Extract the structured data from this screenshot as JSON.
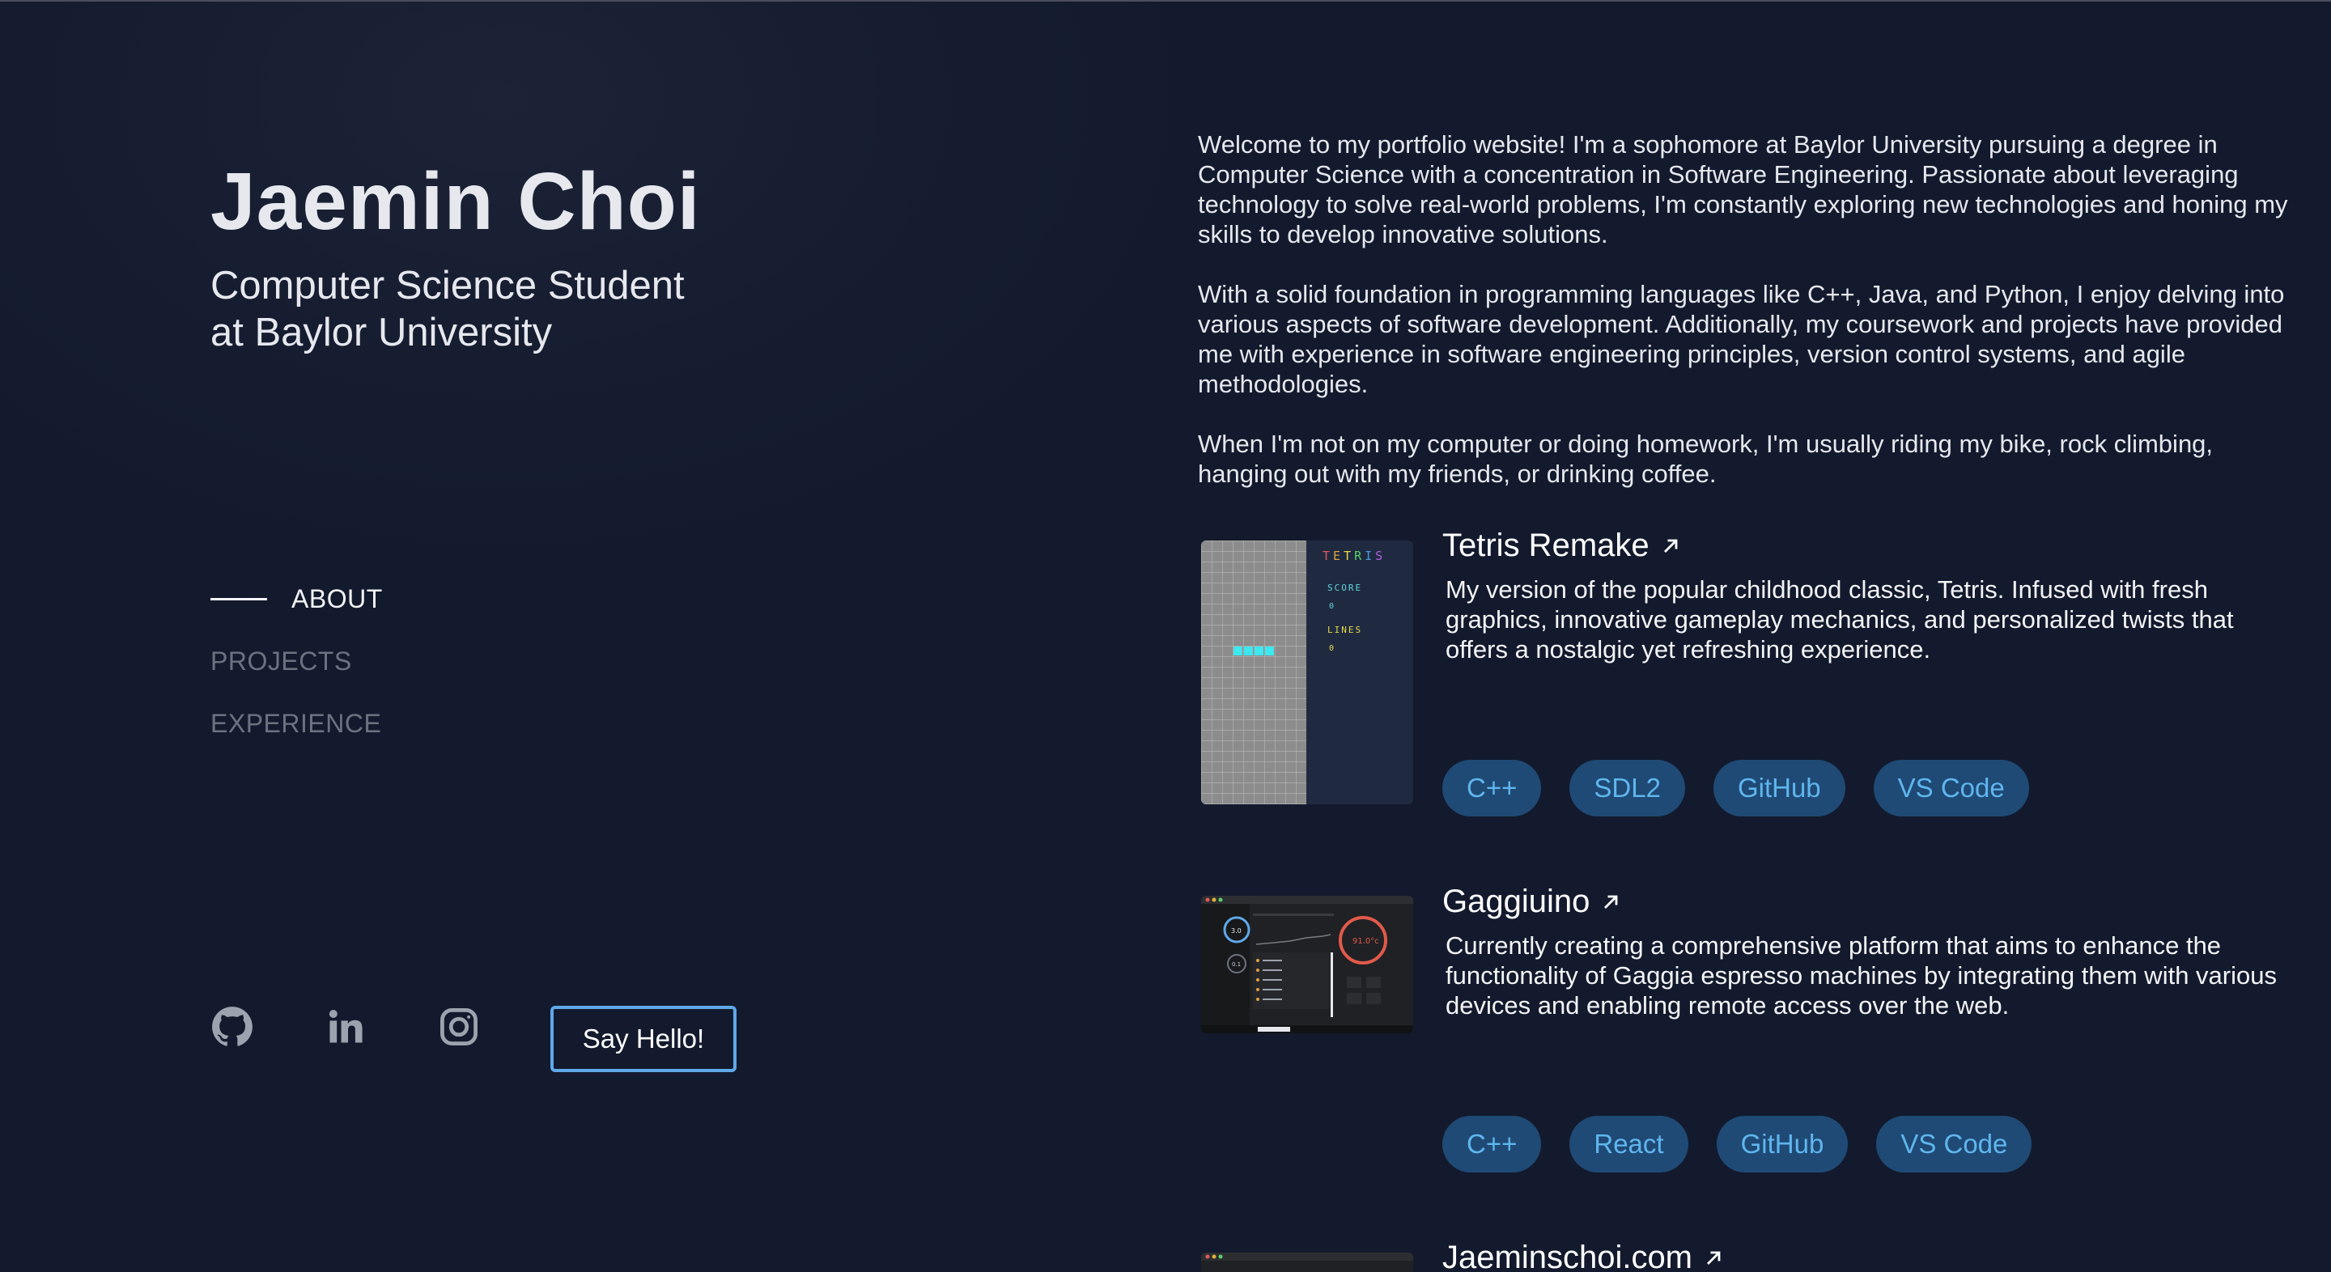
{
  "hero": {
    "name": "Jaemin Choi",
    "subtitle": "Computer Science Student at Baylor University"
  },
  "nav": {
    "items": [
      {
        "label": "ABOUT",
        "active": true
      },
      {
        "label": "PROJECTS",
        "active": false
      },
      {
        "label": "EXPERIENCE",
        "active": false
      }
    ]
  },
  "socials": {
    "icons": [
      "github-icon",
      "linkedin-icon",
      "instagram-icon"
    ],
    "cta_label": "Say Hello!"
  },
  "about": {
    "paragraphs": [
      "Welcome to my portfolio website! I'm a sophomore at Baylor University pursuing a degree in Computer Science with a concentration in Software Engineering. Passionate about leveraging technology to solve real-world problems, I'm constantly exploring new technologies and honing my skills to develop innovative solutions.",
      "With a solid foundation in programming languages like C++, Java, and Python, I enjoy delving into various aspects of software development. Additionally, my coursework and projects have provided me with experience in software engineering principles, version control systems, and agile methodologies.",
      "When I'm not on my computer or doing homework, I'm usually riding my bike, rock climbing, hanging out with my friends, or drinking coffee."
    ]
  },
  "projects": [
    {
      "title": "Tetris Remake",
      "description": "My version of the popular childhood classic, Tetris. Infused with fresh graphics, innovative gameplay mechanics, and personalized twists that offers a nostalgic yet refreshing experience.",
      "tags": [
        "C++",
        "SDL2",
        "GitHub",
        "VS Code"
      ],
      "thumbnail": {
        "logo": "TETRIS",
        "score_label": "SCORE",
        "score_value": "0",
        "lines_label": "LINES",
        "lines_value": "0"
      }
    },
    {
      "title": "Gaggiuino",
      "description": "Currently creating a comprehensive platform that aims to enhance the functionality of Gaggia espresso machines by integrating them with various devices and enabling remote access over the web.",
      "tags": [
        "C++",
        "React",
        "GitHub",
        "VS Code"
      ],
      "thumbnail": {
        "temp_readout": "91.0°c",
        "pressure_readout": "3.0",
        "weight_readout": "0.1"
      }
    },
    {
      "title": "Jaeminschoi.com"
    }
  ],
  "colors": {
    "background": "#141b2f",
    "accent": "#5fa8e8",
    "tag_bg": "#1f4a75",
    "tag_text": "#5fb6ee",
    "muted_nav": "#6b7280"
  }
}
